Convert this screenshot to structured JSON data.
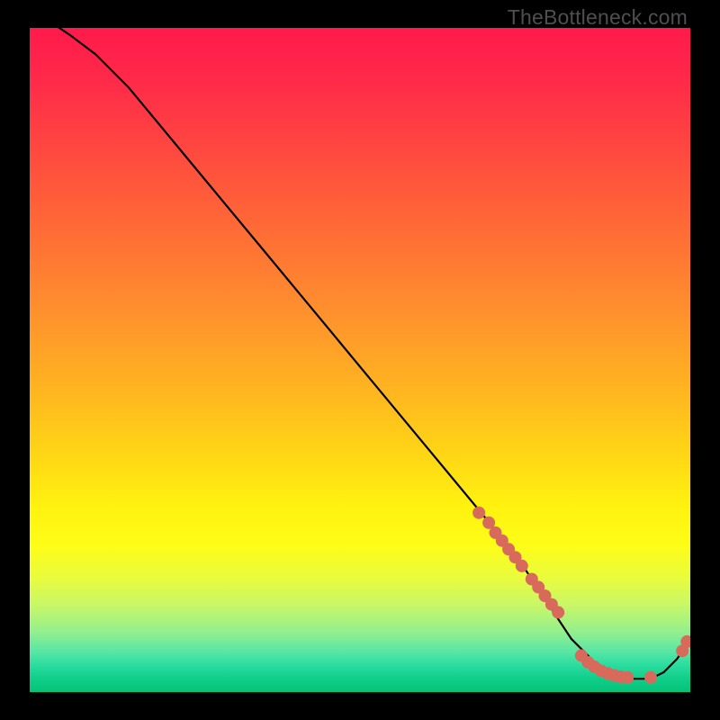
{
  "credit": "TheBottleneck.com",
  "chart_data": {
    "type": "line",
    "title": "",
    "xlabel": "",
    "ylabel": "",
    "xlim": [
      0,
      100
    ],
    "ylim": [
      0,
      100
    ],
    "grid": false,
    "legend": false,
    "series": [
      {
        "name": "curve",
        "x": [
          0,
          3,
          6,
          10,
          15,
          20,
          25,
          30,
          35,
          40,
          45,
          50,
          55,
          60,
          65,
          70,
          72,
          74,
          76,
          78,
          80,
          82,
          84,
          86,
          88,
          90,
          91,
          92,
          94,
          96,
          98,
          100
        ],
        "y": [
          102,
          101,
          99,
          96,
          91,
          85,
          79,
          73,
          67,
          61,
          55,
          49,
          43,
          37,
          31,
          25,
          22,
          20,
          17,
          14,
          11,
          8,
          6,
          4,
          3,
          2,
          2,
          2,
          2,
          3,
          5,
          8
        ]
      }
    ],
    "markers": {
      "name": "highlight-points",
      "color": "#d86a5c",
      "x": [
        68,
        69.5,
        70.5,
        71.5,
        72.5,
        73.5,
        74.5,
        76,
        77,
        78,
        79,
        80,
        83.5,
        84.5,
        85.5,
        86.5,
        87.5,
        88.5,
        89.5,
        90.5,
        94,
        98.8,
        99.5
      ],
      "y": [
        27,
        25.5,
        24,
        22.8,
        21.5,
        20.3,
        19,
        17,
        15.8,
        14.5,
        13.2,
        12,
        5.5,
        4.5,
        3.8,
        3.2,
        2.8,
        2.5,
        2.3,
        2.2,
        2.2,
        6.2,
        7.6
      ]
    }
  }
}
